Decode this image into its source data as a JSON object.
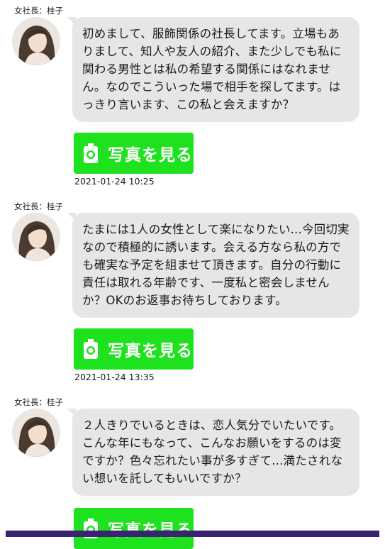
{
  "messages": [
    {
      "sender": "女社長：桂子",
      "text": "初めまして、服飾関係の社長してます。立場もありまして、知人や友人の紹介、また少しでも私に関わる男性とは私の希望する関係にはなれません。なのでこういった場で相手を探してます。はっきり言います、この私と会えますか？",
      "button_label": "写真を見る",
      "timestamp": "2021-01-24 10:25"
    },
    {
      "sender": "女社長：桂子",
      "text": "たまには1人の女性として楽になりたい...今回切実なので積極的に誘います。会える方なら私の方でも確実な予定を組ませて頂きます。自分の行動に責任は取れる年齢です、一度私と密会しませんか？OKのお返事お待ちしております。",
      "button_label": "写真を見る",
      "timestamp": "2021-01-24 13:35"
    },
    {
      "sender": "女社長：桂子",
      "text": "２人きりでいるときは、恋人気分でいたいです。こんな年にもなって、こんなお願いをするのは変ですか？色々忘れたい事が多すぎて...満たされない想いを託してもいいですか？",
      "button_label": "写真を見る",
      "timestamp": ""
    }
  ],
  "icons": {
    "photo_button": "camera-icon",
    "avatar": "woman-portrait"
  },
  "colors": {
    "bubble": "#e6e6e6",
    "photo_button": "#1ee21e",
    "bottom_bar": "#3a2370"
  }
}
